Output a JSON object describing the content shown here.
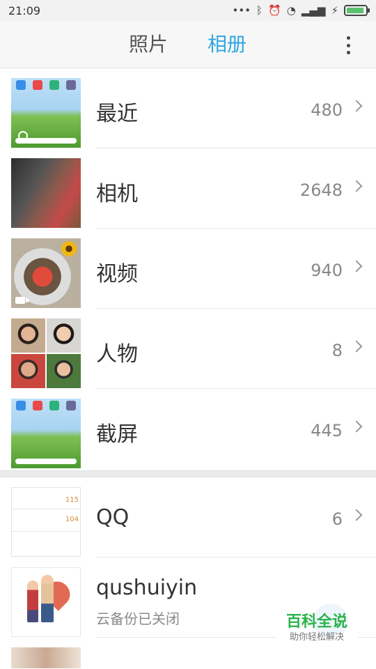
{
  "status_bar": {
    "time": "21:09",
    "icons": [
      "more-dots-icon",
      "bluetooth-icon",
      "alarm-icon",
      "wifi-icon",
      "signal-icon",
      "charging-icon",
      "battery-icon"
    ]
  },
  "header": {
    "tabs": [
      {
        "label": "照片",
        "active": false
      },
      {
        "label": "相册",
        "active": true
      }
    ],
    "active_color": "#2fa6e3"
  },
  "albums": [
    {
      "name": "最近",
      "count": "480",
      "thumb": "desktop-screenshot"
    },
    {
      "name": "相机",
      "count": "2648",
      "thumb": "camera-photo"
    },
    {
      "name": "视频",
      "count": "940",
      "thumb": "video-strawberries"
    },
    {
      "name": "人物",
      "count": "8",
      "thumb": "people-faces"
    },
    {
      "name": "截屏",
      "count": "445",
      "thumb": "desktop-screenshot"
    }
  ],
  "other_albums": [
    {
      "name": "QQ",
      "count": "6",
      "thumb": "qq-doc",
      "thumb_text": [
        "115",
        "104"
      ]
    },
    {
      "name": "qushuiyin",
      "subtitle": "云备份已关闭",
      "thumb": "couple-illustration"
    }
  ],
  "watermark": {
    "title": "百科全说",
    "subtitle": "助你轻松解决"
  }
}
